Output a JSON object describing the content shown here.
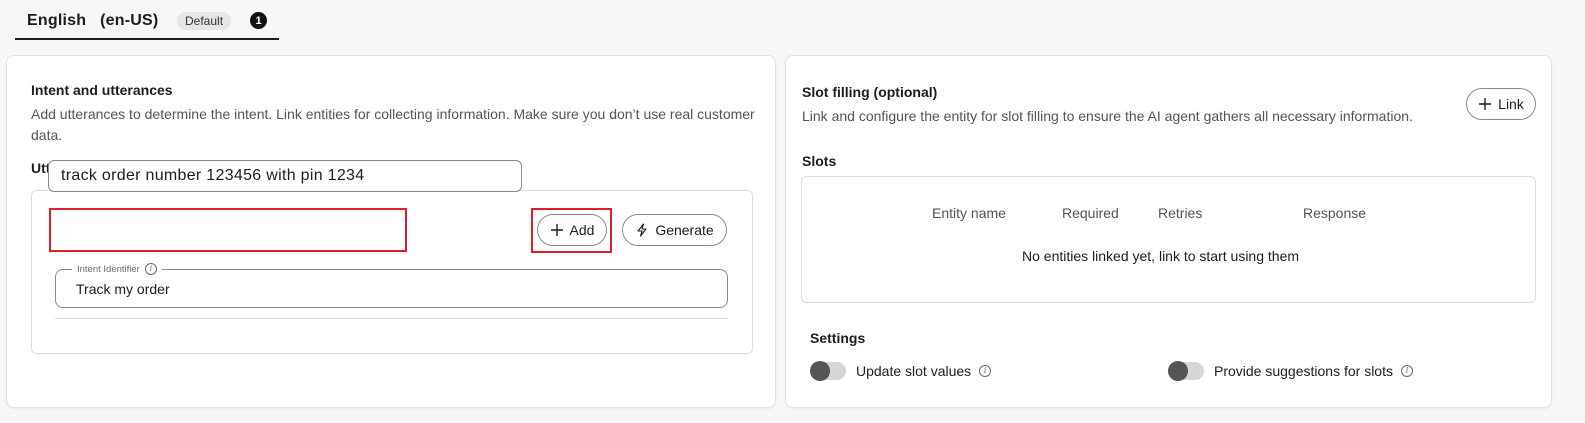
{
  "language_tab": {
    "name": "English   (en-US)",
    "badge": "Default",
    "count": "1"
  },
  "intent_panel": {
    "title": "Intent and utterances",
    "description": "Add utterances to determine the intent. Link entities for collecting information. Make sure you don’t use real customer data.",
    "utterances_label": "Utterances",
    "required_mark": "*",
    "utterance_value": "track order number 123456 with pin 1234",
    "add_label": "Add",
    "generate_label": "Generate",
    "intent_identifier_label": "Intent Identifier",
    "intent_identifier_value": "Track my order"
  },
  "slot_panel": {
    "title": "Slot filling (optional)",
    "description": "Link and configure the entity for slot filling to ensure the AI agent gathers all necessary information.",
    "link_label": "Link",
    "slots_label": "Slots",
    "columns": [
      "Entity name",
      "Required",
      "Retries",
      "Response"
    ],
    "empty_message": "No entities linked yet, link to start using them",
    "settings_label": "Settings",
    "toggles": [
      {
        "label": "Update slot values",
        "on": false
      },
      {
        "label": "Provide suggestions for slots",
        "on": false
      }
    ]
  },
  "colors": {
    "highlight": "#e11d2a",
    "text": "#1d1d1d",
    "muted": "#545454"
  }
}
